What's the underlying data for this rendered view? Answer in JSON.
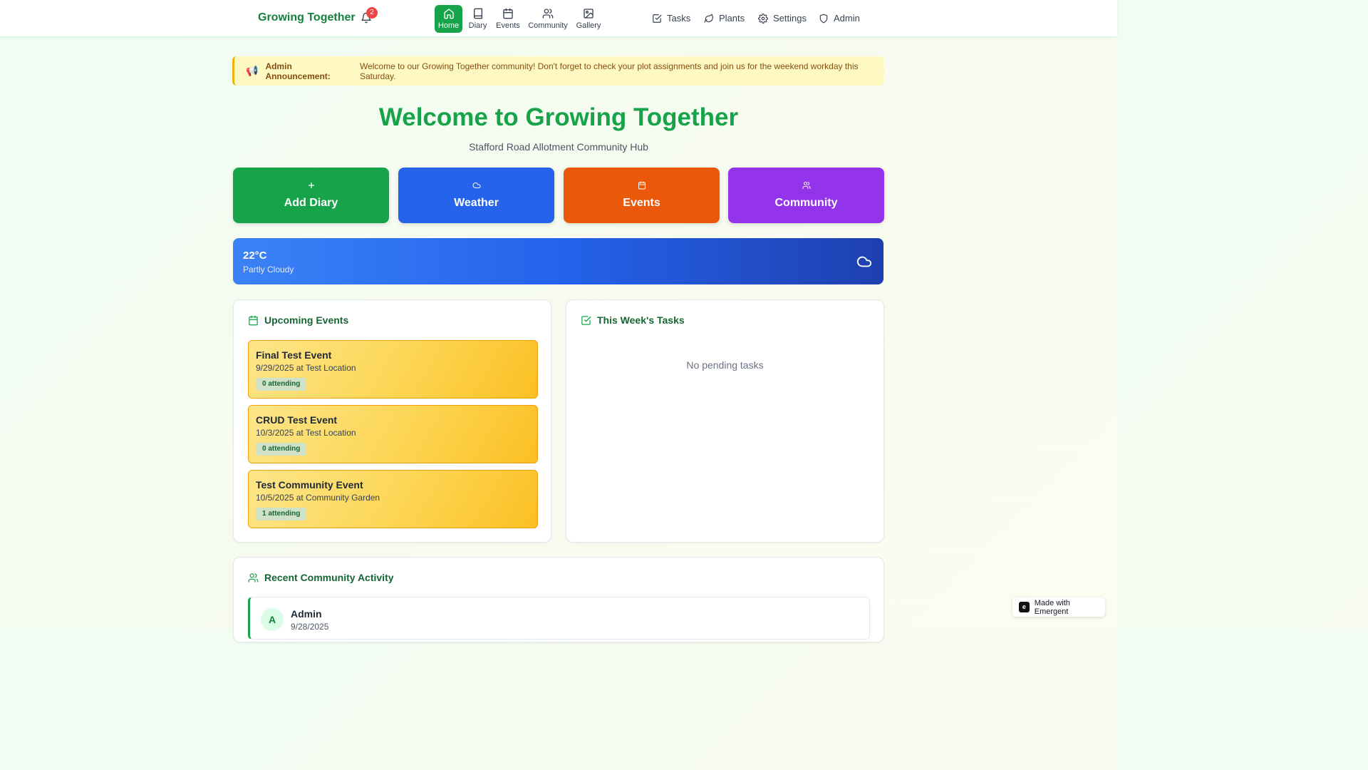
{
  "header": {
    "brand": "Growing Together",
    "notification_count": "2",
    "tabs": [
      {
        "label": "Home",
        "icon": "home-icon",
        "active": true
      },
      {
        "label": "Diary",
        "icon": "book-icon"
      },
      {
        "label": "Events",
        "icon": "calendar-icon"
      },
      {
        "label": "Community",
        "icon": "users-icon"
      },
      {
        "label": "Gallery",
        "icon": "image-icon"
      }
    ],
    "links": [
      {
        "label": "Tasks",
        "icon": "check-square-icon"
      },
      {
        "label": "Plants",
        "icon": "leaf-icon"
      },
      {
        "label": "Settings",
        "icon": "gear-icon"
      },
      {
        "label": "Admin",
        "icon": "shield-icon"
      }
    ]
  },
  "announcement": {
    "prefix": "Admin Announcement:",
    "text": "Welcome to our Growing Together community! Don't forget to check your plot assignments and join us for the weekend workday this Saturday."
  },
  "hero": {
    "title": "Welcome to Growing Together",
    "subtitle": "Stafford Road Allotment Community Hub"
  },
  "quick_actions": [
    {
      "label": "Add Diary",
      "icon": "plus-icon",
      "color": "#16a34a"
    },
    {
      "label": "Weather",
      "icon": "cloud-icon",
      "color": "#2563eb"
    },
    {
      "label": "Events",
      "icon": "calendar-icon",
      "color": "#ea580c"
    },
    {
      "label": "Community",
      "icon": "users-icon",
      "color": "#9333ea"
    }
  ],
  "weather": {
    "temperature": "22°C",
    "condition": "Partly Cloudy"
  },
  "events_card": {
    "title": "Upcoming Events",
    "events": [
      {
        "title": "Final Test Event",
        "meta": "9/29/2025 at Test Location",
        "attending": "0 attending"
      },
      {
        "title": "CRUD Test Event",
        "meta": "10/3/2025 at Test Location",
        "attending": "0 attending"
      },
      {
        "title": "Test Community Event",
        "meta": "10/5/2025 at Community Garden",
        "attending": "1 attending"
      }
    ]
  },
  "tasks_card": {
    "title": "This Week's Tasks",
    "empty_text": "No pending tasks"
  },
  "activity_card": {
    "title": "Recent Community Activity",
    "items": [
      {
        "initial": "A",
        "name": "Admin",
        "date": "9/28/2025"
      }
    ]
  },
  "badge": {
    "label": "Made with Emergent"
  }
}
